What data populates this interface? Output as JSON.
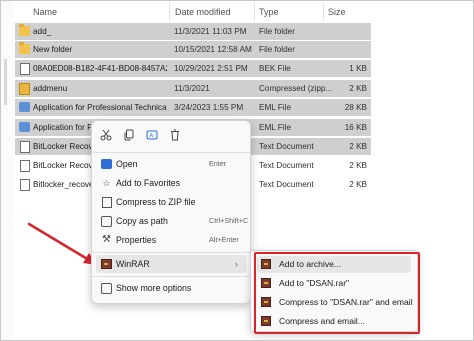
{
  "columns": {
    "name": "Name",
    "date": "Date modified",
    "type": "Type",
    "size": "Size"
  },
  "rows": [
    {
      "name": "add_",
      "date": "11/3/2021 11:03 PM",
      "type": "File folder",
      "size": "",
      "icon": "folder-icon",
      "selected": true
    },
    {
      "name": "New folder",
      "date": "10/15/2021 12:58 AM",
      "type": "File folder",
      "size": "",
      "icon": "folder-icon",
      "selected": true
    },
    {
      "name": "08A0ED08-B182-4F41-BD08-8457A2C9D...",
      "date": "10/29/2021 2:51 PM",
      "type": "BEK File",
      "size": "1 KB",
      "icon": "file-icon",
      "selected": true
    },
    {
      "name": "addmenu",
      "date": "11/3/2021",
      "type": "Compressed (zipp...",
      "size": "2 KB",
      "icon": "zip-icon",
      "selected": true
    },
    {
      "name": "Application for Professional Technical Wr...",
      "date": "3/24/2023 1:55 PM",
      "type": "EML File",
      "size": "28 KB",
      "icon": "mail-icon",
      "selected": true
    },
    {
      "name": "Application for Pr",
      "date": "",
      "type": "EML File",
      "size": "16 KB",
      "icon": "mail-icon",
      "selected": true
    },
    {
      "name": "BitLocker Recover",
      "date": "",
      "type": "Text Document",
      "size": "2 KB",
      "icon": "document-icon",
      "selected": true
    },
    {
      "name": "BitLocker Recover",
      "date": "",
      "type": "Text Document",
      "size": "2 KB",
      "icon": "document-icon",
      "selected": false
    },
    {
      "name": "Bitlocker_recovery",
      "date": "",
      "type": "Text Document",
      "size": "2 KB",
      "icon": "document-icon",
      "selected": false
    }
  ],
  "quick_actions": [
    "cut-icon",
    "copy-icon",
    "rename-icon",
    "delete-icon"
  ],
  "context_menu": {
    "open": {
      "label": "Open",
      "shortcut": "Enter"
    },
    "favorites": {
      "label": "Add to Favorites"
    },
    "compress_zip": {
      "label": "Compress to ZIP file"
    },
    "copy_path": {
      "label": "Copy as path",
      "shortcut": "Ctrl+Shift+C"
    },
    "properties": {
      "label": "Properties",
      "shortcut": "Alt+Enter"
    },
    "winrar": {
      "label": "WinRAR"
    },
    "more_options": {
      "label": "Show more options"
    }
  },
  "winrar_submenu": [
    {
      "label": "Add to archive..."
    },
    {
      "label": "Add to \"DSAN.rar\""
    },
    {
      "label": "Compress to \"DSAN.rar\" and email"
    },
    {
      "label": "Compress and email..."
    }
  ],
  "colors": {
    "highlight_box": "#d7262b",
    "arrow": "#d7262b",
    "selection": "#cfcfcf"
  }
}
